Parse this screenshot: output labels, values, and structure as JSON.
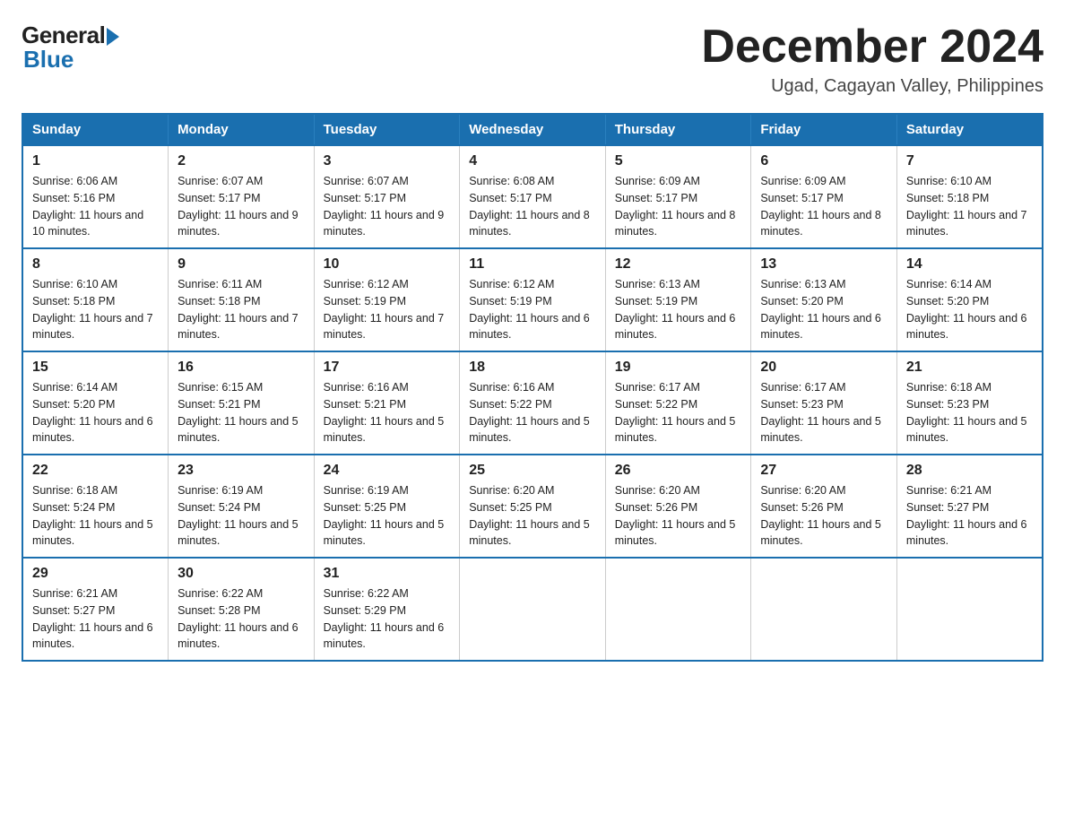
{
  "logo": {
    "general": "General",
    "blue": "Blue"
  },
  "header": {
    "month": "December 2024",
    "location": "Ugad, Cagayan Valley, Philippines"
  },
  "days_of_week": [
    "Sunday",
    "Monday",
    "Tuesday",
    "Wednesday",
    "Thursday",
    "Friday",
    "Saturday"
  ],
  "weeks": [
    [
      {
        "day": "1",
        "sunrise": "6:06 AM",
        "sunset": "5:16 PM",
        "daylight": "11 hours and 10 minutes."
      },
      {
        "day": "2",
        "sunrise": "6:07 AM",
        "sunset": "5:17 PM",
        "daylight": "11 hours and 9 minutes."
      },
      {
        "day": "3",
        "sunrise": "6:07 AM",
        "sunset": "5:17 PM",
        "daylight": "11 hours and 9 minutes."
      },
      {
        "day": "4",
        "sunrise": "6:08 AM",
        "sunset": "5:17 PM",
        "daylight": "11 hours and 8 minutes."
      },
      {
        "day": "5",
        "sunrise": "6:09 AM",
        "sunset": "5:17 PM",
        "daylight": "11 hours and 8 minutes."
      },
      {
        "day": "6",
        "sunrise": "6:09 AM",
        "sunset": "5:17 PM",
        "daylight": "11 hours and 8 minutes."
      },
      {
        "day": "7",
        "sunrise": "6:10 AM",
        "sunset": "5:18 PM",
        "daylight": "11 hours and 7 minutes."
      }
    ],
    [
      {
        "day": "8",
        "sunrise": "6:10 AM",
        "sunset": "5:18 PM",
        "daylight": "11 hours and 7 minutes."
      },
      {
        "day": "9",
        "sunrise": "6:11 AM",
        "sunset": "5:18 PM",
        "daylight": "11 hours and 7 minutes."
      },
      {
        "day": "10",
        "sunrise": "6:12 AM",
        "sunset": "5:19 PM",
        "daylight": "11 hours and 7 minutes."
      },
      {
        "day": "11",
        "sunrise": "6:12 AM",
        "sunset": "5:19 PM",
        "daylight": "11 hours and 6 minutes."
      },
      {
        "day": "12",
        "sunrise": "6:13 AM",
        "sunset": "5:19 PM",
        "daylight": "11 hours and 6 minutes."
      },
      {
        "day": "13",
        "sunrise": "6:13 AM",
        "sunset": "5:20 PM",
        "daylight": "11 hours and 6 minutes."
      },
      {
        "day": "14",
        "sunrise": "6:14 AM",
        "sunset": "5:20 PM",
        "daylight": "11 hours and 6 minutes."
      }
    ],
    [
      {
        "day": "15",
        "sunrise": "6:14 AM",
        "sunset": "5:20 PM",
        "daylight": "11 hours and 6 minutes."
      },
      {
        "day": "16",
        "sunrise": "6:15 AM",
        "sunset": "5:21 PM",
        "daylight": "11 hours and 5 minutes."
      },
      {
        "day": "17",
        "sunrise": "6:16 AM",
        "sunset": "5:21 PM",
        "daylight": "11 hours and 5 minutes."
      },
      {
        "day": "18",
        "sunrise": "6:16 AM",
        "sunset": "5:22 PM",
        "daylight": "11 hours and 5 minutes."
      },
      {
        "day": "19",
        "sunrise": "6:17 AM",
        "sunset": "5:22 PM",
        "daylight": "11 hours and 5 minutes."
      },
      {
        "day": "20",
        "sunrise": "6:17 AM",
        "sunset": "5:23 PM",
        "daylight": "11 hours and 5 minutes."
      },
      {
        "day": "21",
        "sunrise": "6:18 AM",
        "sunset": "5:23 PM",
        "daylight": "11 hours and 5 minutes."
      }
    ],
    [
      {
        "day": "22",
        "sunrise": "6:18 AM",
        "sunset": "5:24 PM",
        "daylight": "11 hours and 5 minutes."
      },
      {
        "day": "23",
        "sunrise": "6:19 AM",
        "sunset": "5:24 PM",
        "daylight": "11 hours and 5 minutes."
      },
      {
        "day": "24",
        "sunrise": "6:19 AM",
        "sunset": "5:25 PM",
        "daylight": "11 hours and 5 minutes."
      },
      {
        "day": "25",
        "sunrise": "6:20 AM",
        "sunset": "5:25 PM",
        "daylight": "11 hours and 5 minutes."
      },
      {
        "day": "26",
        "sunrise": "6:20 AM",
        "sunset": "5:26 PM",
        "daylight": "11 hours and 5 minutes."
      },
      {
        "day": "27",
        "sunrise": "6:20 AM",
        "sunset": "5:26 PM",
        "daylight": "11 hours and 5 minutes."
      },
      {
        "day": "28",
        "sunrise": "6:21 AM",
        "sunset": "5:27 PM",
        "daylight": "11 hours and 6 minutes."
      }
    ],
    [
      {
        "day": "29",
        "sunrise": "6:21 AM",
        "sunset": "5:27 PM",
        "daylight": "11 hours and 6 minutes."
      },
      {
        "day": "30",
        "sunrise": "6:22 AM",
        "sunset": "5:28 PM",
        "daylight": "11 hours and 6 minutes."
      },
      {
        "day": "31",
        "sunrise": "6:22 AM",
        "sunset": "5:29 PM",
        "daylight": "11 hours and 6 minutes."
      },
      {
        "day": "",
        "sunrise": "",
        "sunset": "",
        "daylight": ""
      },
      {
        "day": "",
        "sunrise": "",
        "sunset": "",
        "daylight": ""
      },
      {
        "day": "",
        "sunrise": "",
        "sunset": "",
        "daylight": ""
      },
      {
        "day": "",
        "sunrise": "",
        "sunset": "",
        "daylight": ""
      }
    ]
  ]
}
